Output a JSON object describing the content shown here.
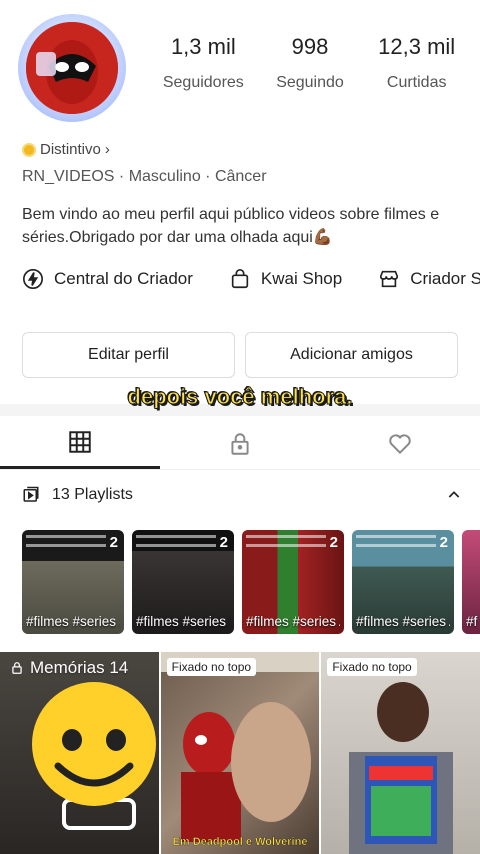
{
  "profile": {
    "stats": [
      {
        "value": "1,3 mil",
        "label": "Seguidores"
      },
      {
        "value": "998",
        "label": "Seguindo"
      },
      {
        "value": "12,3 mil",
        "label": "Curtidas"
      }
    ],
    "badge": "Distintivo",
    "badge_chevron": "›",
    "meta": "RN_VIDEOS · Masculino · Câncer",
    "bio": "Bem vindo ao meu perfil aqui público videos sobre filmes e séries.Obrigado por dar uma olhada aqui💪🏾"
  },
  "shortcuts": [
    {
      "label": "Central do Criador",
      "icon": "bolt-icon"
    },
    {
      "label": "Kwai Shop",
      "icon": "bag-icon"
    },
    {
      "label": "Criador S",
      "icon": "store-icon"
    }
  ],
  "buttons": {
    "edit": "Editar perfil",
    "add_friends": "Adicionar amigos"
  },
  "overlay_caption": "depois você melhora.",
  "tabs": [
    {
      "name": "grid",
      "icon": "grid-icon",
      "active": true
    },
    {
      "name": "private",
      "icon": "lock-icon",
      "active": false
    },
    {
      "name": "liked",
      "icon": "heart-icon",
      "active": false
    }
  ],
  "playlists": {
    "header": "13 Playlists",
    "items": [
      {
        "count": "2",
        "title": "#filmes #series #ce...",
        "bg": "#5a5a4e"
      },
      {
        "count": "2",
        "title": "#filmes #series \"Te...",
        "bg": "#2c2a2a"
      },
      {
        "count": "2",
        "title": "#filmes #series Abe...",
        "bg": "#7a2020"
      },
      {
        "count": "2",
        "title": "#filmes #series Abe...",
        "bg": "#3f5a52"
      },
      {
        "count": "",
        "title": "#f #C",
        "bg": "#8a3a5a"
      }
    ]
  },
  "videos": [
    {
      "type": "memories",
      "label": "Memórias 14"
    },
    {
      "type": "pinned",
      "pin": "Fixado no topo",
      "caption": "Em Deadpool e Wolverine"
    },
    {
      "type": "pinned",
      "pin": "Fixado no topo",
      "caption": ""
    }
  ],
  "colors": {
    "accent_caption": "#ffe14a",
    "badge": "#f2b81d"
  }
}
